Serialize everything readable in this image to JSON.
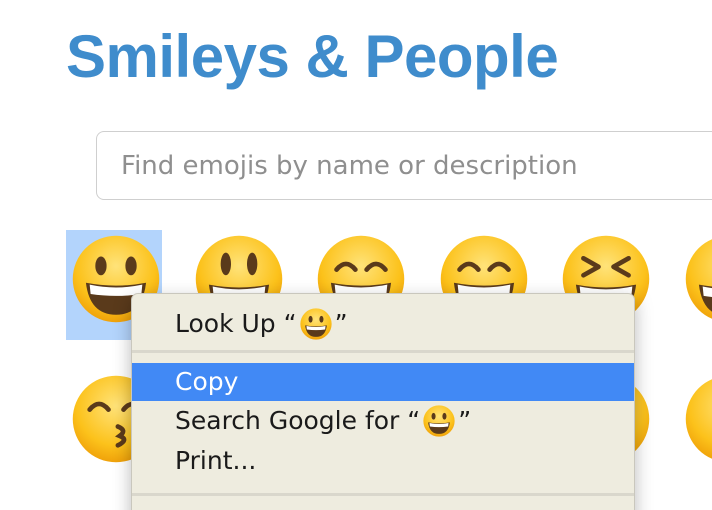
{
  "page": {
    "title": "Smileys & People"
  },
  "search": {
    "placeholder": "Find emojis by name or description",
    "value": ""
  },
  "emoji_grid": {
    "row1": [
      {
        "name": "grinning-face",
        "selected": true
      },
      {
        "name": "smiling-face-with-open-mouth",
        "selected": false
      },
      {
        "name": "grinning-face-with-smiling-eyes",
        "selected": false
      },
      {
        "name": "smiling-face-with-open-mouth-and-smiling-eyes",
        "selected": false
      },
      {
        "name": "squinting-face-with-tongue-out-eyes",
        "selected": false
      },
      {
        "name": "grinning-face-partial",
        "selected": false
      }
    ],
    "row2": [
      {
        "name": "kissing-face-with-smiling-eyes",
        "selected": false
      },
      {
        "name": "partial-emoji",
        "selected": false
      },
      {
        "name": "partial-emoji",
        "selected": false
      }
    ]
  },
  "context_menu": {
    "look_up": {
      "prefix": "Look Up “",
      "suffix": " ”"
    },
    "copy": "Copy",
    "search_google": {
      "prefix": "Search Google for “",
      "suffix": " ”"
    },
    "print": "Print..."
  },
  "colors": {
    "title": "#3f8ccc",
    "selection": "#b3d4fc",
    "menu_bg": "#eeecdf",
    "menu_highlight": "#4189f5"
  }
}
